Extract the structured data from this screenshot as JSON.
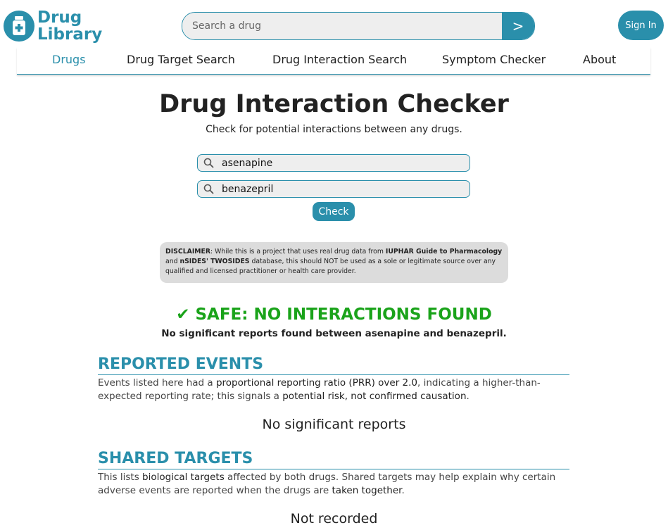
{
  "header": {
    "logo_line1": "Drug",
    "logo_line2": "Library",
    "search_placeholder": "Search a drug",
    "search_button": ">",
    "signin_label": "Sign In"
  },
  "nav": {
    "items": [
      {
        "label": "Drugs",
        "active": true
      },
      {
        "label": "Drug Target Search",
        "active": false
      },
      {
        "label": "Drug Interaction Search",
        "active": false
      },
      {
        "label": "Symptom Checker",
        "active": false
      },
      {
        "label": "About",
        "active": false
      }
    ]
  },
  "checker": {
    "title": "Drug Interaction Checker",
    "subtitle": "Check for potential interactions between any drugs.",
    "drug1": "asenapine",
    "drug2": "benazepril",
    "check_label": "Check"
  },
  "disclaimer": {
    "label": "DISCLAIMER",
    "text1": ": While this is a project that uses real drug data from ",
    "source1": "IUPHAR Guide to Pharmacology",
    "text2": " and ",
    "source2": "nSIDES' TWOSIDES",
    "text3": " database, this should NOT be used as a sole or legitimate source over any qualified and licensed practitioner or health care provider."
  },
  "result": {
    "title": "✔ SAFE: NO INTERACTIONS FOUND",
    "subtitle": "No significant reports found between asenapine and benazepril."
  },
  "reported_events": {
    "heading": "REPORTED EVENTS",
    "t1": "Events listed here had a ",
    "b1": "proportional reporting ratio (PRR) over 2.0",
    "t2": ", indicating a higher-than-expected reporting rate; this signals a ",
    "b2": "potential risk, not confirmed causation",
    "t3": ".",
    "empty": "No significant reports"
  },
  "shared_targets": {
    "heading": "SHARED TARGETS",
    "t1": "This lists ",
    "b1": "biological targets",
    "t2": " affected by both drugs. Shared targets may help explain why certain adverse events are reported when the drugs are ",
    "b2": "taken together",
    "t3": ".",
    "empty": "Not recorded"
  },
  "colors": {
    "accent": "#2a8fab",
    "safe": "#1aa31a",
    "disclaimer_bg": "#dcdcdc"
  }
}
